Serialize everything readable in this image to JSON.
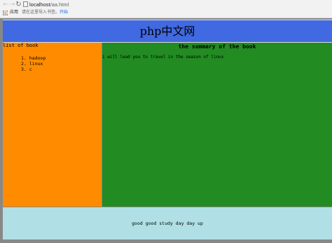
{
  "browser": {
    "back_icon": "arrow-left-icon",
    "forward_icon": "arrow-right-icon",
    "reload_icon": "reload-icon",
    "url_host": "localhost",
    "url_path": "/aa.html",
    "bookmarks": {
      "apps_label": "应用",
      "import_text": "请在这里导入书签。",
      "start_link": "开始"
    }
  },
  "header": {
    "title": "php中文网",
    "background": "#4169e1"
  },
  "sidebar": {
    "title": "list of book",
    "background": "#ff8c00",
    "books": [
      {
        "number": "1.",
        "name": "hadoop"
      },
      {
        "number": "2.",
        "name": "linux"
      },
      {
        "number": "3.",
        "name": "c"
      }
    ]
  },
  "main": {
    "title": "the summary of the book",
    "text": "i will lead you to travel in the season of linux",
    "background": "#228b22"
  },
  "footer": {
    "text": "good good study day day up",
    "background": "#b0e0e6"
  }
}
